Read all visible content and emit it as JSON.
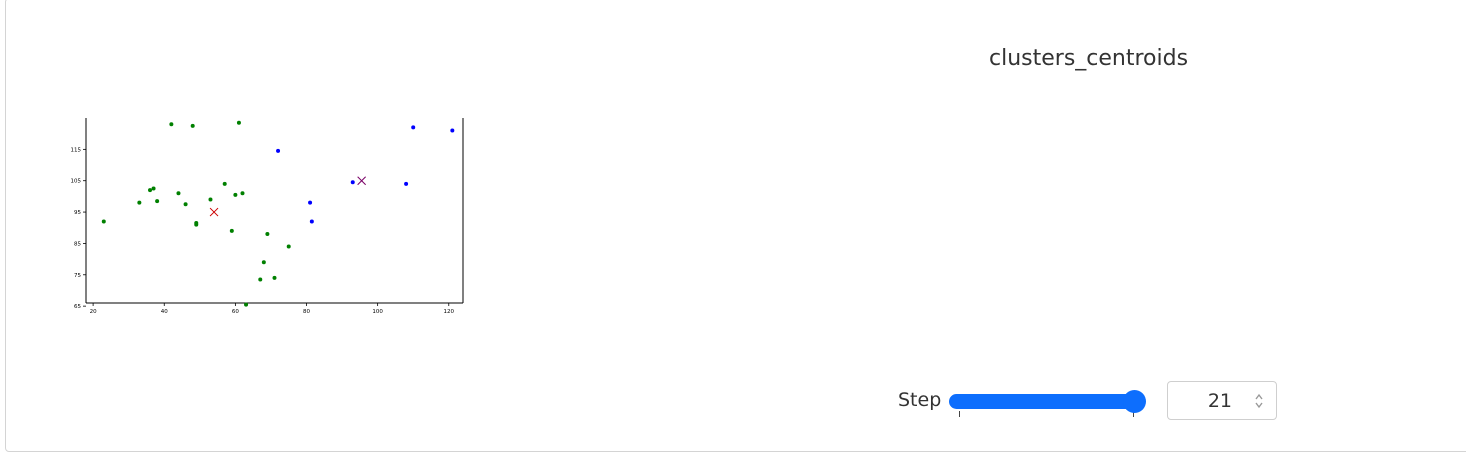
{
  "title": "clusters_centroids",
  "controls": {
    "step_label": "Step",
    "step_value": "21",
    "slider": {
      "min": 0,
      "max": 21,
      "value": 21
    }
  },
  "colors": {
    "cluster_green": "#008000",
    "cluster_blue": "#0000ff",
    "centroid_red": "#cc0000",
    "centroid_purple": "#7a0066",
    "accent": "#0d6efd"
  },
  "chart_data": {
    "type": "scatter",
    "title": "",
    "xlabel": "",
    "ylabel": "",
    "xlim": [
      18,
      124
    ],
    "ylim": [
      66,
      125
    ],
    "x_ticks": [
      "20",
      "40",
      "60",
      "80",
      "100",
      "120"
    ],
    "y_ticks": [
      "65",
      "75",
      "85",
      "95",
      "105",
      "115"
    ],
    "series": [
      {
        "color": "#008000",
        "marker": "dot",
        "points": [
          [
            23,
            92
          ],
          [
            33,
            98
          ],
          [
            36,
            102
          ],
          [
            37,
            102.5
          ],
          [
            38,
            98.5
          ],
          [
            42,
            123
          ],
          [
            44,
            101
          ],
          [
            46,
            97.5
          ],
          [
            48,
            122.5
          ],
          [
            49,
            91.5
          ],
          [
            49,
            91
          ],
          [
            53,
            99
          ],
          [
            57,
            104
          ],
          [
            59,
            89
          ],
          [
            60,
            100.5
          ],
          [
            61,
            123.5
          ],
          [
            62,
            101
          ],
          [
            63,
            65.5
          ],
          [
            67,
            73.5
          ],
          [
            68,
            79
          ],
          [
            69,
            88
          ],
          [
            71,
            74
          ],
          [
            75,
            84
          ]
        ]
      },
      {
        "color": "#0000ff",
        "marker": "dot",
        "points": [
          [
            72,
            114.5
          ],
          [
            81,
            98
          ],
          [
            81.5,
            92
          ],
          [
            93,
            104.5
          ],
          [
            108,
            104
          ],
          [
            110,
            122
          ],
          [
            121,
            121
          ]
        ]
      },
      {
        "color": "#cc0000",
        "marker": "x",
        "points": [
          [
            54,
            95
          ]
        ]
      },
      {
        "color": "#7a0066",
        "marker": "x",
        "points": [
          [
            95.5,
            105
          ]
        ]
      }
    ]
  }
}
